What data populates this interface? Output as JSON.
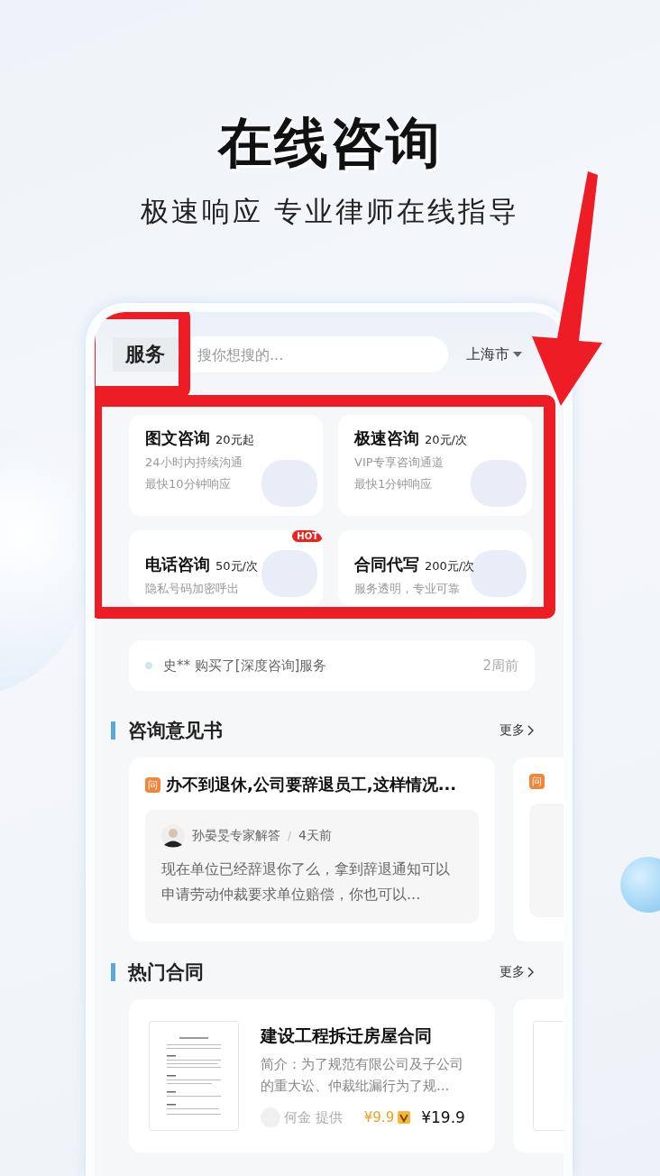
{
  "headline": "在线咨询",
  "subtitle": "极速响应 专业律师在线指导",
  "app": {
    "header": {
      "tab": {
        "label": "服务",
        "highlighted": true
      },
      "search": {
        "placeholder": "搜你想搜的..."
      },
      "city": "上海市"
    },
    "services_highlighted": true,
    "services": [
      {
        "title": "图文咨询",
        "price": "20元起",
        "lines": [
          "24小时内持续沟通",
          "最快10分钟响应"
        ]
      },
      {
        "title": "极速咨询",
        "price": "20元/次",
        "lines": [
          "VIP专享咨询通道",
          "最快1分钟响应"
        ]
      },
      {
        "title": "电话咨询",
        "price": "50元/次",
        "lines": [
          "隐私号码加密呼出"
        ],
        "badge": "HOT"
      },
      {
        "title": "合同代写",
        "price": "200元/次",
        "lines": [
          "服务透明，专业可靠"
        ]
      }
    ],
    "notice": {
      "text": "史** 购买了[深度咨询]服务",
      "time": "2周前"
    },
    "opinions": {
      "title": "咨询意见书",
      "more": "更多",
      "items": [
        {
          "kind": "full",
          "tag": "问",
          "question": "办不到退休,公司要辞退员工,这样情况...",
          "expert": "孙晏旻专家解答",
          "separator": "/",
          "time": "4天前",
          "answer": "现在单位已经辞退你了么，拿到辞退通知可以申请劳动仲裁要求单位赔偿，你也可以..."
        },
        {
          "kind": "peek",
          "tag": "问"
        }
      ]
    },
    "contracts": {
      "title": "热门合同",
      "more": "更多",
      "items": [
        {
          "kind": "full",
          "name": "建设工程拆迁房屋合同",
          "intro": "简介：为了规范有限公司及子公司的重大讼、仲裁纰漏行为了规...",
          "provider": "何金 提供",
          "member_price": "¥9.9",
          "price": "¥19.9"
        },
        {
          "kind": "peek"
        }
      ]
    }
  }
}
